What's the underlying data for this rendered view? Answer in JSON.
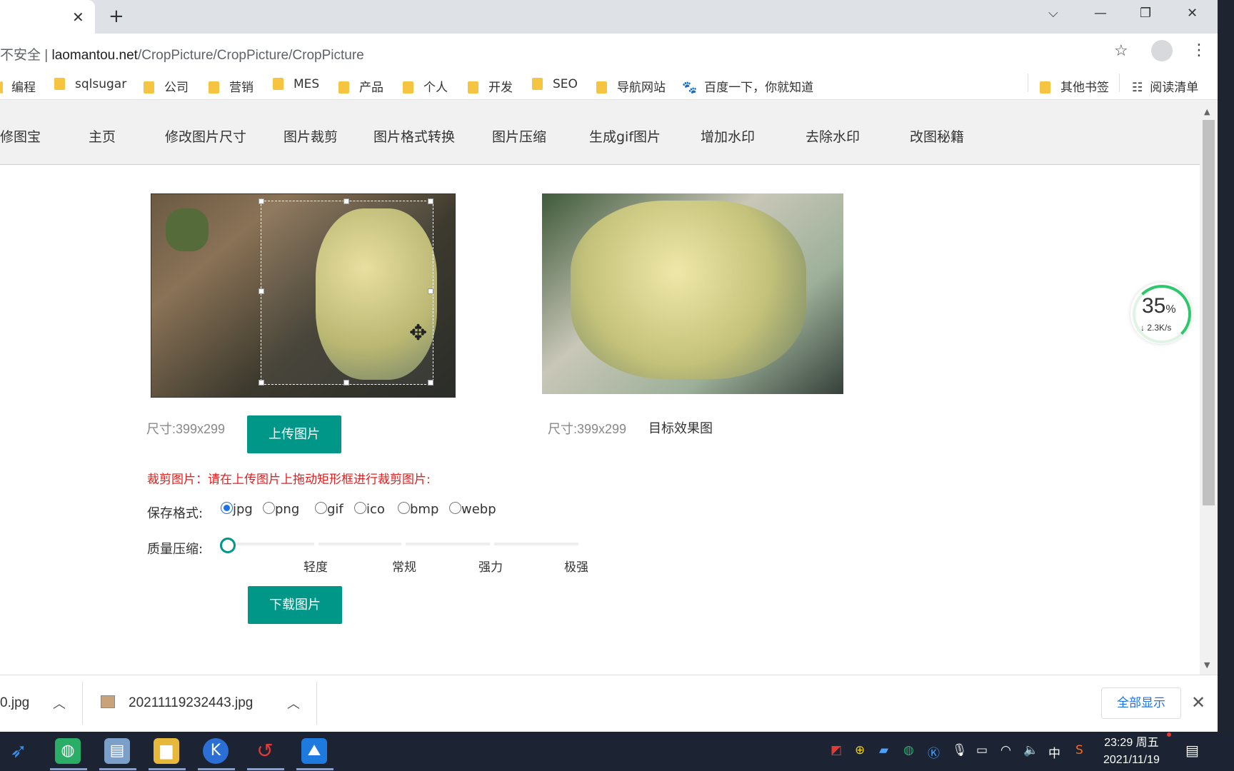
{
  "tab": {
    "close": "✕",
    "new_tab": "+"
  },
  "window": {
    "dropdown": "⌵",
    "minimize": "—",
    "restore": "❐",
    "close": "✕"
  },
  "address": {
    "insecure": "不安全",
    "host": "laomantou.net",
    "path": "/CropPicture/CropPicture/CropPicture"
  },
  "bookmarks": [
    "编程",
    "sqlsugar",
    "公司",
    "营销",
    "MES",
    "产品",
    "个人",
    "开发",
    "SEO",
    "导航网站",
    "百度一下，你就知道"
  ],
  "bookmarks_right": {
    "other": "其他书签",
    "reading": "阅读清单"
  },
  "nav": [
    "修图宝",
    "主页",
    "修改图片尺寸",
    "图片裁剪",
    "图片格式转换",
    "图片压缩",
    "生成gif图片",
    "增加水印",
    "去除水印",
    "改图秘籍"
  ],
  "source": {
    "size": "尺寸:399x299",
    "upload_label": "上传图片"
  },
  "target": {
    "size": "尺寸:399x299",
    "caption": "目标效果图"
  },
  "instruction": "裁剪图片：请在上传图片上拖动矩形框进行裁剪图片:",
  "format": {
    "label": "保存格式:",
    "options": [
      "jpg",
      "png",
      "gif",
      "ico",
      "bmp",
      "webp"
    ],
    "selected": "jpg"
  },
  "quality": {
    "label": "质量压缩:",
    "ticks": [
      "轻度",
      "常规",
      "强力",
      "极强"
    ],
    "value": 0
  },
  "download_label": "下载图片",
  "speed_widget": {
    "percent": "35",
    "unit": "%",
    "speed": "↓ 2.3K/s"
  },
  "downloads": {
    "item1": "0.jpg",
    "item2": "20211119232443.jpg",
    "show_all": "全部显示",
    "close": "✕"
  },
  "taskbar": {
    "ime": "中",
    "time": "23:29 周五",
    "date": "2021/11/19"
  },
  "colors": {
    "accent": "#009688",
    "warning": "#e02020",
    "selected_radio": "#1a73e8"
  }
}
